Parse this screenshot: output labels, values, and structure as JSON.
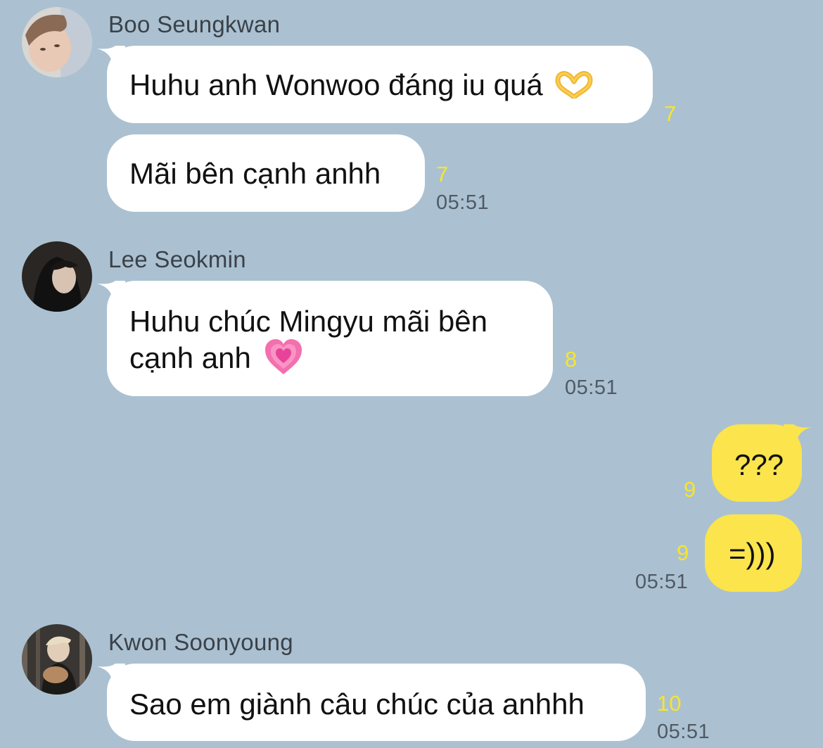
{
  "messages": [
    {
      "sender": "Boo Seungkwan",
      "bubbles": [
        {
          "text": "Huhu anh Wonwoo đáng iu quá",
          "emoji": "heart-hands-emoji",
          "count": "7"
        },
        {
          "text": "Mãi bên cạnh anhh",
          "count": "7",
          "time": "05:51"
        }
      ]
    },
    {
      "sender": "Lee Seokmin",
      "bubbles": [
        {
          "line1": "Huhu chúc Mingyu mãi bên",
          "line2": "cạnh anh",
          "emoji": "growing-heart-emoji",
          "count": "8",
          "time": "05:51"
        }
      ]
    },
    {
      "sender": "me",
      "bubbles": [
        {
          "text": "???",
          "count": "9"
        },
        {
          "text": "=)))",
          "count": "9",
          "time": "05:51"
        }
      ]
    },
    {
      "sender": "Kwon Soonyoung",
      "bubbles": [
        {
          "text": "Sao em giành câu chúc của anhhh",
          "count": "10",
          "time": "05:51"
        }
      ]
    }
  ],
  "colors": {
    "background": "#abc1d1",
    "incoming_bubble": "#ffffff",
    "outgoing_bubble": "#fbe44c",
    "unread_count": "#f6e52d",
    "timestamp": "#4f5a64"
  }
}
